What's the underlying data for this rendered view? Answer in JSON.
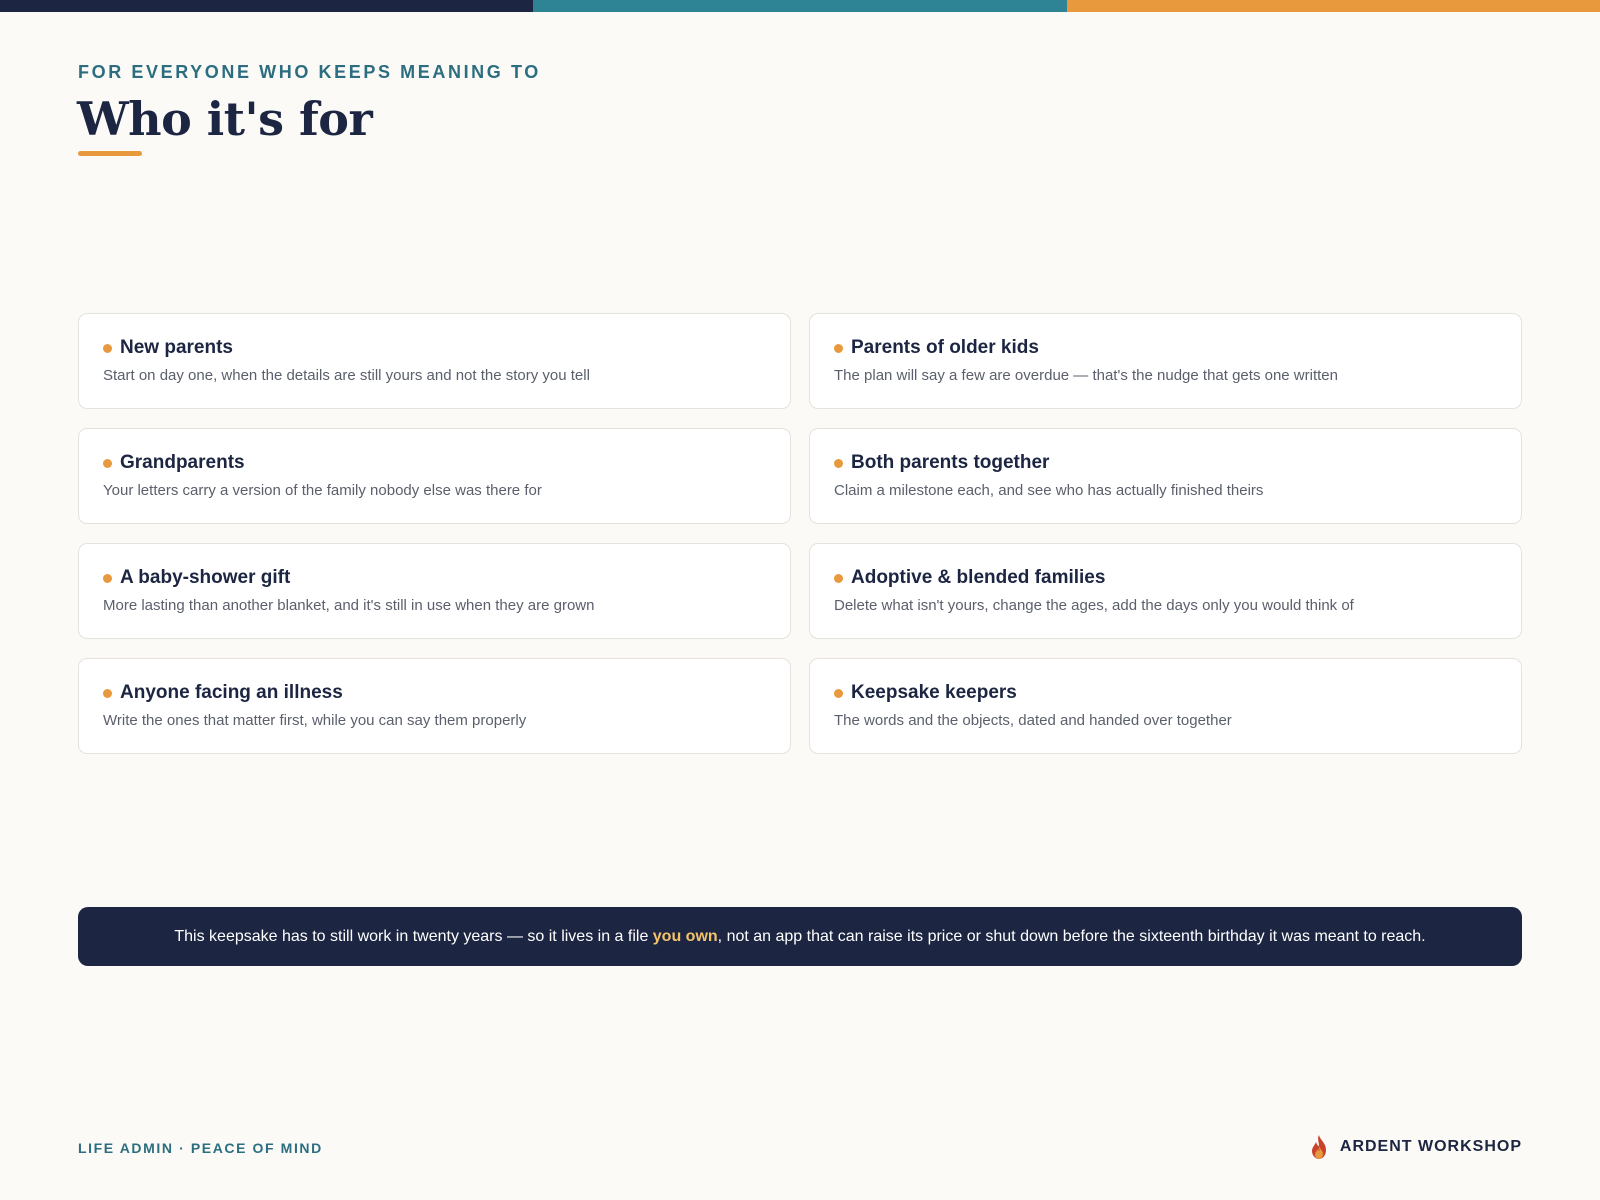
{
  "colors": {
    "navy": "#1c2541",
    "teal": "#2e8494",
    "orange": "#e8993d",
    "highlight": "#f2c36b",
    "eyebrow": "#2c6e80"
  },
  "header": {
    "eyebrow": "FOR EVERYONE WHO KEEPS MEANING TO",
    "title": "Who it's for"
  },
  "cards": [
    {
      "title": "New parents",
      "desc": "Start on day one, when the details are still yours and not the story you tell"
    },
    {
      "title": "Parents of older kids",
      "desc": "The plan will say a few are overdue — that's the nudge that gets one written"
    },
    {
      "title": "Grandparents",
      "desc": "Your letters carry a version of the family nobody else was there for"
    },
    {
      "title": "Both parents together",
      "desc": "Claim a milestone each, and see who has actually finished theirs"
    },
    {
      "title": "A baby-shower gift",
      "desc": "More lasting than another blanket, and it's still in use when they are grown"
    },
    {
      "title": "Adoptive & blended families",
      "desc": "Delete what isn't yours, change the ages, add the days only you would think of"
    },
    {
      "title": "Anyone facing an illness",
      "desc": "Write the ones that matter first, while you can say them properly"
    },
    {
      "title": "Keepsake keepers",
      "desc": "The words and the objects, dated and handed over together"
    }
  ],
  "banner": {
    "before": "This keepsake has to still work in twenty years — so it lives in a file ",
    "highlight": "you own",
    "after": ", not an app that can raise its price or shut down before the sixteenth birthday it was meant to reach."
  },
  "footer": {
    "tagline": "LIFE ADMIN · PEACE OF MIND",
    "brand": "ARDENT WORKSHOP",
    "logo_icon": "flame-icon"
  }
}
